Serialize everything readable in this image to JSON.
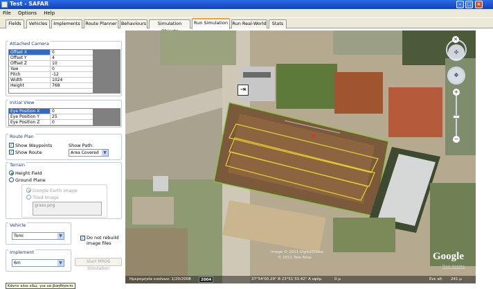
{
  "window": {
    "title": "Test - SAFAR"
  },
  "menu": [
    "File",
    "Options",
    "Help"
  ],
  "tabs": [
    "Fields",
    "Vehicles",
    "Implements",
    "Route Planner",
    "Behaviours",
    "Simulation Objects",
    "Run Simulation",
    "Run Real-World",
    "Stats"
  ],
  "active_tab": "Run Simulation",
  "attached_camera": {
    "title": "Attached Camera",
    "rows": [
      {
        "key": "Offset X",
        "value": "0"
      },
      {
        "key": "Offset Y",
        "value": "4"
      },
      {
        "key": "Offset Z",
        "value": "10"
      },
      {
        "key": "Yaw",
        "value": "0"
      },
      {
        "key": "Pitch",
        "value": "-12"
      },
      {
        "key": "Width",
        "value": "1024"
      },
      {
        "key": "Height",
        "value": "768"
      }
    ]
  },
  "initial_view": {
    "title": "Initial View",
    "rows": [
      {
        "key": "Eye Position X",
        "value": "0"
      },
      {
        "key": "Eye Position Y",
        "value": "25"
      },
      {
        "key": "Eye Position Z",
        "value": "0"
      }
    ]
  },
  "route_plan": {
    "title": "Route Plan",
    "show_waypoints": "Show Waypoints",
    "show_route": "Show Route",
    "show_path_label": "Show Path:",
    "show_path_value": "Area Covered"
  },
  "terrain": {
    "title": "Terrain",
    "height_field": "Height Field",
    "ground_plane": "Ground Plane",
    "google_earth_image": "Google Earth Image",
    "tiled_image": "Tiled Image",
    "texture_file": "grass.png"
  },
  "vehicle": {
    "title": "Vehicle",
    "value": "Tomi",
    "do_not_rebuild": "Do not rebuild image files"
  },
  "implement": {
    "title": "Implement",
    "value": "6m"
  },
  "start_button": "Start MRDS Simulation",
  "map": {
    "copyright1": "Image © 2011 DigitalGlobe",
    "copyright2": "© 2011 Tele Atlas",
    "google_logo": "Google",
    "terms_link": "Όροι Χρήσης",
    "status_date": "Ημερομηνία εικόνων: 1/20/2008",
    "status_year": "2004",
    "status_coords": "37°54'00.29\" Β 23°51'33.42\" Α υψόμ",
    "status_elev": "0 μ",
    "status_eye": "Ευε alt",
    "status_eye_val": "241 μ"
  },
  "tooltip": "Κάντε κλικ εδώ, για να βοηθήσετε",
  "colors": {
    "title_bar": "#1f5ad6",
    "selection": "#316ac5",
    "route_yellow": "#e8d030",
    "field_green": "#7ccf3a"
  }
}
